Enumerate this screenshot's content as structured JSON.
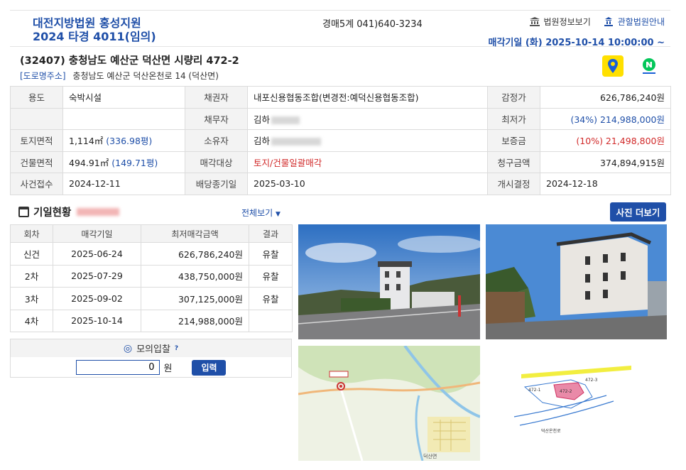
{
  "header": {
    "court": "대전지방법원 홍성지원",
    "case_no": "2024 타경 4011(임의)",
    "department": "경매5계 041)640-3234",
    "link_info": "법원정보보기",
    "link_guide": "관할법원안내",
    "sale_date": "매각기일  (화) 2025-10-14 10:00:00 ~"
  },
  "property": {
    "address": "(32407) 충청남도 예산군 덕산면 시량리 472-2",
    "road_tag": "[도로명주소]",
    "road_address": "충청남도 예산군 덕산온천로 14 (덕산면)"
  },
  "info": {
    "use_label": "용도",
    "use": "숙박시설",
    "creditor_label": "채권자",
    "creditor": "내포신용협동조합(변경전:예덕신용협동조합)",
    "appraisal_label": "감정가",
    "appraisal": "626,786,240원",
    "debtor_label": "채무자",
    "debtor": "김하",
    "min_label": "최저가",
    "min": "(34%) 214,988,000원",
    "land_label": "토지면적",
    "land": "1,114㎡",
    "land_py": "(336.98평)",
    "owner_label": "소유자",
    "owner": "김하",
    "deposit_label": "보증금",
    "deposit": "(10%) 21,498,800원",
    "bldg_label": "건물면적",
    "bldg": "494.91㎡",
    "bldg_py": "(149.71평)",
    "target_label": "매각대상",
    "target": "토지/건물일괄매각",
    "claim_label": "청구금액",
    "claim": "374,894,915원",
    "filed_label": "사건접수",
    "filed": "2024-12-11",
    "dist_label": "배당종기일",
    "dist": "2025-03-10",
    "start_label": "개시결정",
    "start": "2024-12-18"
  },
  "history": {
    "title": "기일현황",
    "view_all": "전체보기",
    "more_photos": "사진 더보기",
    "headers": [
      "회차",
      "매각기일",
      "최저매각금액",
      "결과"
    ],
    "rows": [
      {
        "round": "신건",
        "date": "2025-06-24",
        "price": "626,786,240원",
        "result": "유찰"
      },
      {
        "round": "2차",
        "date": "2025-07-29",
        "price": "438,750,000원",
        "result": "유찰"
      },
      {
        "round": "3차",
        "date": "2025-09-02",
        "price": "307,125,000원",
        "result": "유찰"
      },
      {
        "round": "4차",
        "date": "2025-10-14",
        "price": "214,988,000원",
        "result": ""
      }
    ]
  },
  "mock_bid": {
    "title": "모의입찰",
    "value": "0",
    "unit": "원",
    "button": "입력"
  },
  "photos": {
    "map_label": "덕산면",
    "plan_labels": [
      "472-2",
      "472-3",
      "472-1",
      "덕산온천로"
    ]
  },
  "colors": {
    "brand_blue": "#1f4fa8",
    "accent_red": "#d12a2a",
    "kakao_yellow": "#ffe000",
    "naver_green": "#03c75a"
  }
}
